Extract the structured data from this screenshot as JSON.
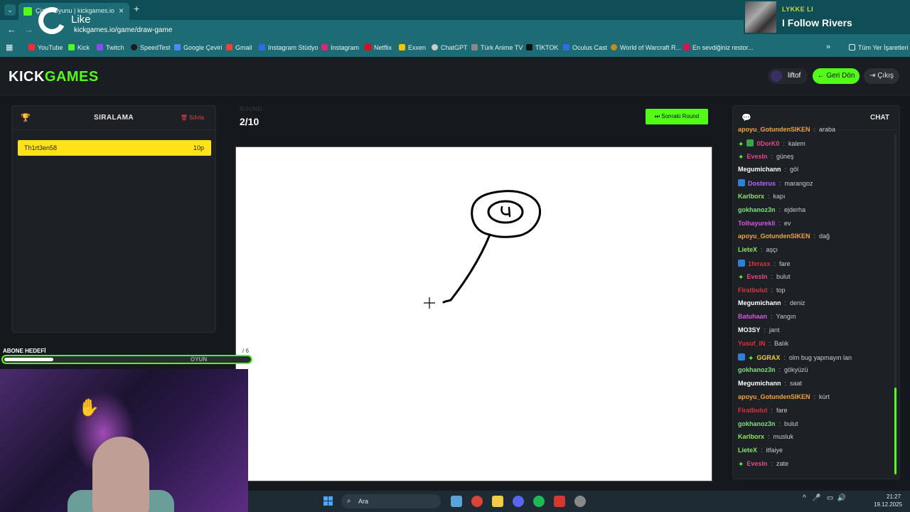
{
  "browser": {
    "tab_title": "Çizim Oyunu | kickgames.io",
    "url_site": "Çizim Oyunu | kickgames.io",
    "url": "kickgames.io/game/draw-game",
    "overlay_text": "Like",
    "bookmarks": [
      "YouTube",
      "Kick",
      "Twitch",
      "SpeedTest",
      "Google Çeviri",
      "Gmail",
      "Instagram Stüdyo",
      "Instagram",
      "Netflix",
      "Exxen",
      "ChatGPT",
      "Türk Anime TV",
      "TİKTOK",
      "Oculus Cast",
      "World of Warcraft R...",
      "En sevdiğiniz restor..."
    ],
    "all_bookmarks": "Tüm Yer İşaretleri"
  },
  "music": {
    "artist": "LYKKE LI",
    "song": "I Follow Rivers"
  },
  "header": {
    "logo_kick": "KICK",
    "logo_games": "GAMES",
    "username": "liftof",
    "back_label": "← Geri Dön",
    "logout_label": "⇥ Çıkış"
  },
  "leaderboard": {
    "title": "SIRALAMA",
    "reset_label": "🗑 Sıfırla",
    "rows": [
      {
        "name": "Th1rt3en58",
        "points": "10p"
      }
    ]
  },
  "round": {
    "label": "ROUND",
    "value": "2/10",
    "next_label": "⏭ Sonraki Round"
  },
  "chat": {
    "title": "CHAT",
    "messages": [
      {
        "user": "apoyu_GotundenSIKEN",
        "text": "araba",
        "color": "#f0a33a",
        "badges": []
      },
      {
        "user": "0DorK0",
        "text": "kalem",
        "color": "#e04a8a",
        "badges": [
          "star",
          "green"
        ]
      },
      {
        "user": "Evesln",
        "text": "güneş",
        "color": "#e04a8a",
        "badges": [
          "star"
        ]
      },
      {
        "user": "Megumichann",
        "text": "göl",
        "color": "#ffffff",
        "badges": []
      },
      {
        "user": "Dosterus",
        "text": "marangoz",
        "color": "#b266ff",
        "badges": [
          "blue"
        ]
      },
      {
        "user": "Karlborx",
        "text": "kapı",
        "color": "#8ae65a",
        "badges": []
      },
      {
        "user": "gokhanoz3n",
        "text": "ejderha",
        "color": "#7ee07a",
        "badges": []
      },
      {
        "user": "Tolhayurekli",
        "text": "ev",
        "color": "#d458e0",
        "badges": []
      },
      {
        "user": "apoyu_GotundenSIKEN",
        "text": "dağ",
        "color": "#f0a33a",
        "badges": []
      },
      {
        "user": "LieteX",
        "text": "aşçı",
        "color": "#8ae65a",
        "badges": []
      },
      {
        "user": "1feraxx",
        "text": "fare",
        "color": "#e0303a",
        "badges": [
          "blue"
        ]
      },
      {
        "user": "Evesln",
        "text": "bulut",
        "color": "#e04a8a",
        "badges": [
          "star"
        ]
      },
      {
        "user": "Firatbulut",
        "text": "top",
        "color": "#e0303a",
        "badges": []
      },
      {
        "user": "Megumichann",
        "text": "deniz",
        "color": "#ffffff",
        "badges": []
      },
      {
        "user": "Batuhaan",
        "text": "Yangın",
        "color": "#d458e0",
        "badges": []
      },
      {
        "user": "MO3SY",
        "text": "jant",
        "color": "#ffffff",
        "badges": []
      },
      {
        "user": "Yusuf_IN",
        "text": "Balık",
        "color": "#e0303a",
        "badges": []
      },
      {
        "user": "GGRAX",
        "text": "olm bug yapmayın lan",
        "color": "#f0d03a",
        "badges": [
          "blue",
          "star"
        ]
      },
      {
        "user": "gokhanoz3n",
        "text": "gökyüzü",
        "color": "#7ee07a",
        "badges": []
      },
      {
        "user": "Megumichann",
        "text": "saat",
        "color": "#ffffff",
        "badges": []
      },
      {
        "user": "apoyu_GotundenSIKEN",
        "text": "kürt",
        "color": "#f0a33a",
        "badges": []
      },
      {
        "user": "Firatbulut",
        "text": "fare",
        "color": "#e0303a",
        "badges": []
      },
      {
        "user": "gokhanoz3n",
        "text": "bulut",
        "color": "#7ee07a",
        "badges": []
      },
      {
        "user": "Karlborx",
        "text": "musluk",
        "color": "#8ae65a",
        "badges": []
      },
      {
        "user": "LieteX",
        "text": "itfaiye",
        "color": "#8ae65a",
        "badges": []
      },
      {
        "user": "Evesln",
        "text": "zate",
        "color": "#e04a8a",
        "badges": [
          "star"
        ]
      }
    ]
  },
  "sub_goal": {
    "title": "ABONE HEDEFİ",
    "label": "OYUN",
    "count": "/ 6",
    "progress_fraction": 0.2
  },
  "taskbar": {
    "search_placeholder": "Ara",
    "time": "21:27",
    "date": "19.12.2025"
  }
}
